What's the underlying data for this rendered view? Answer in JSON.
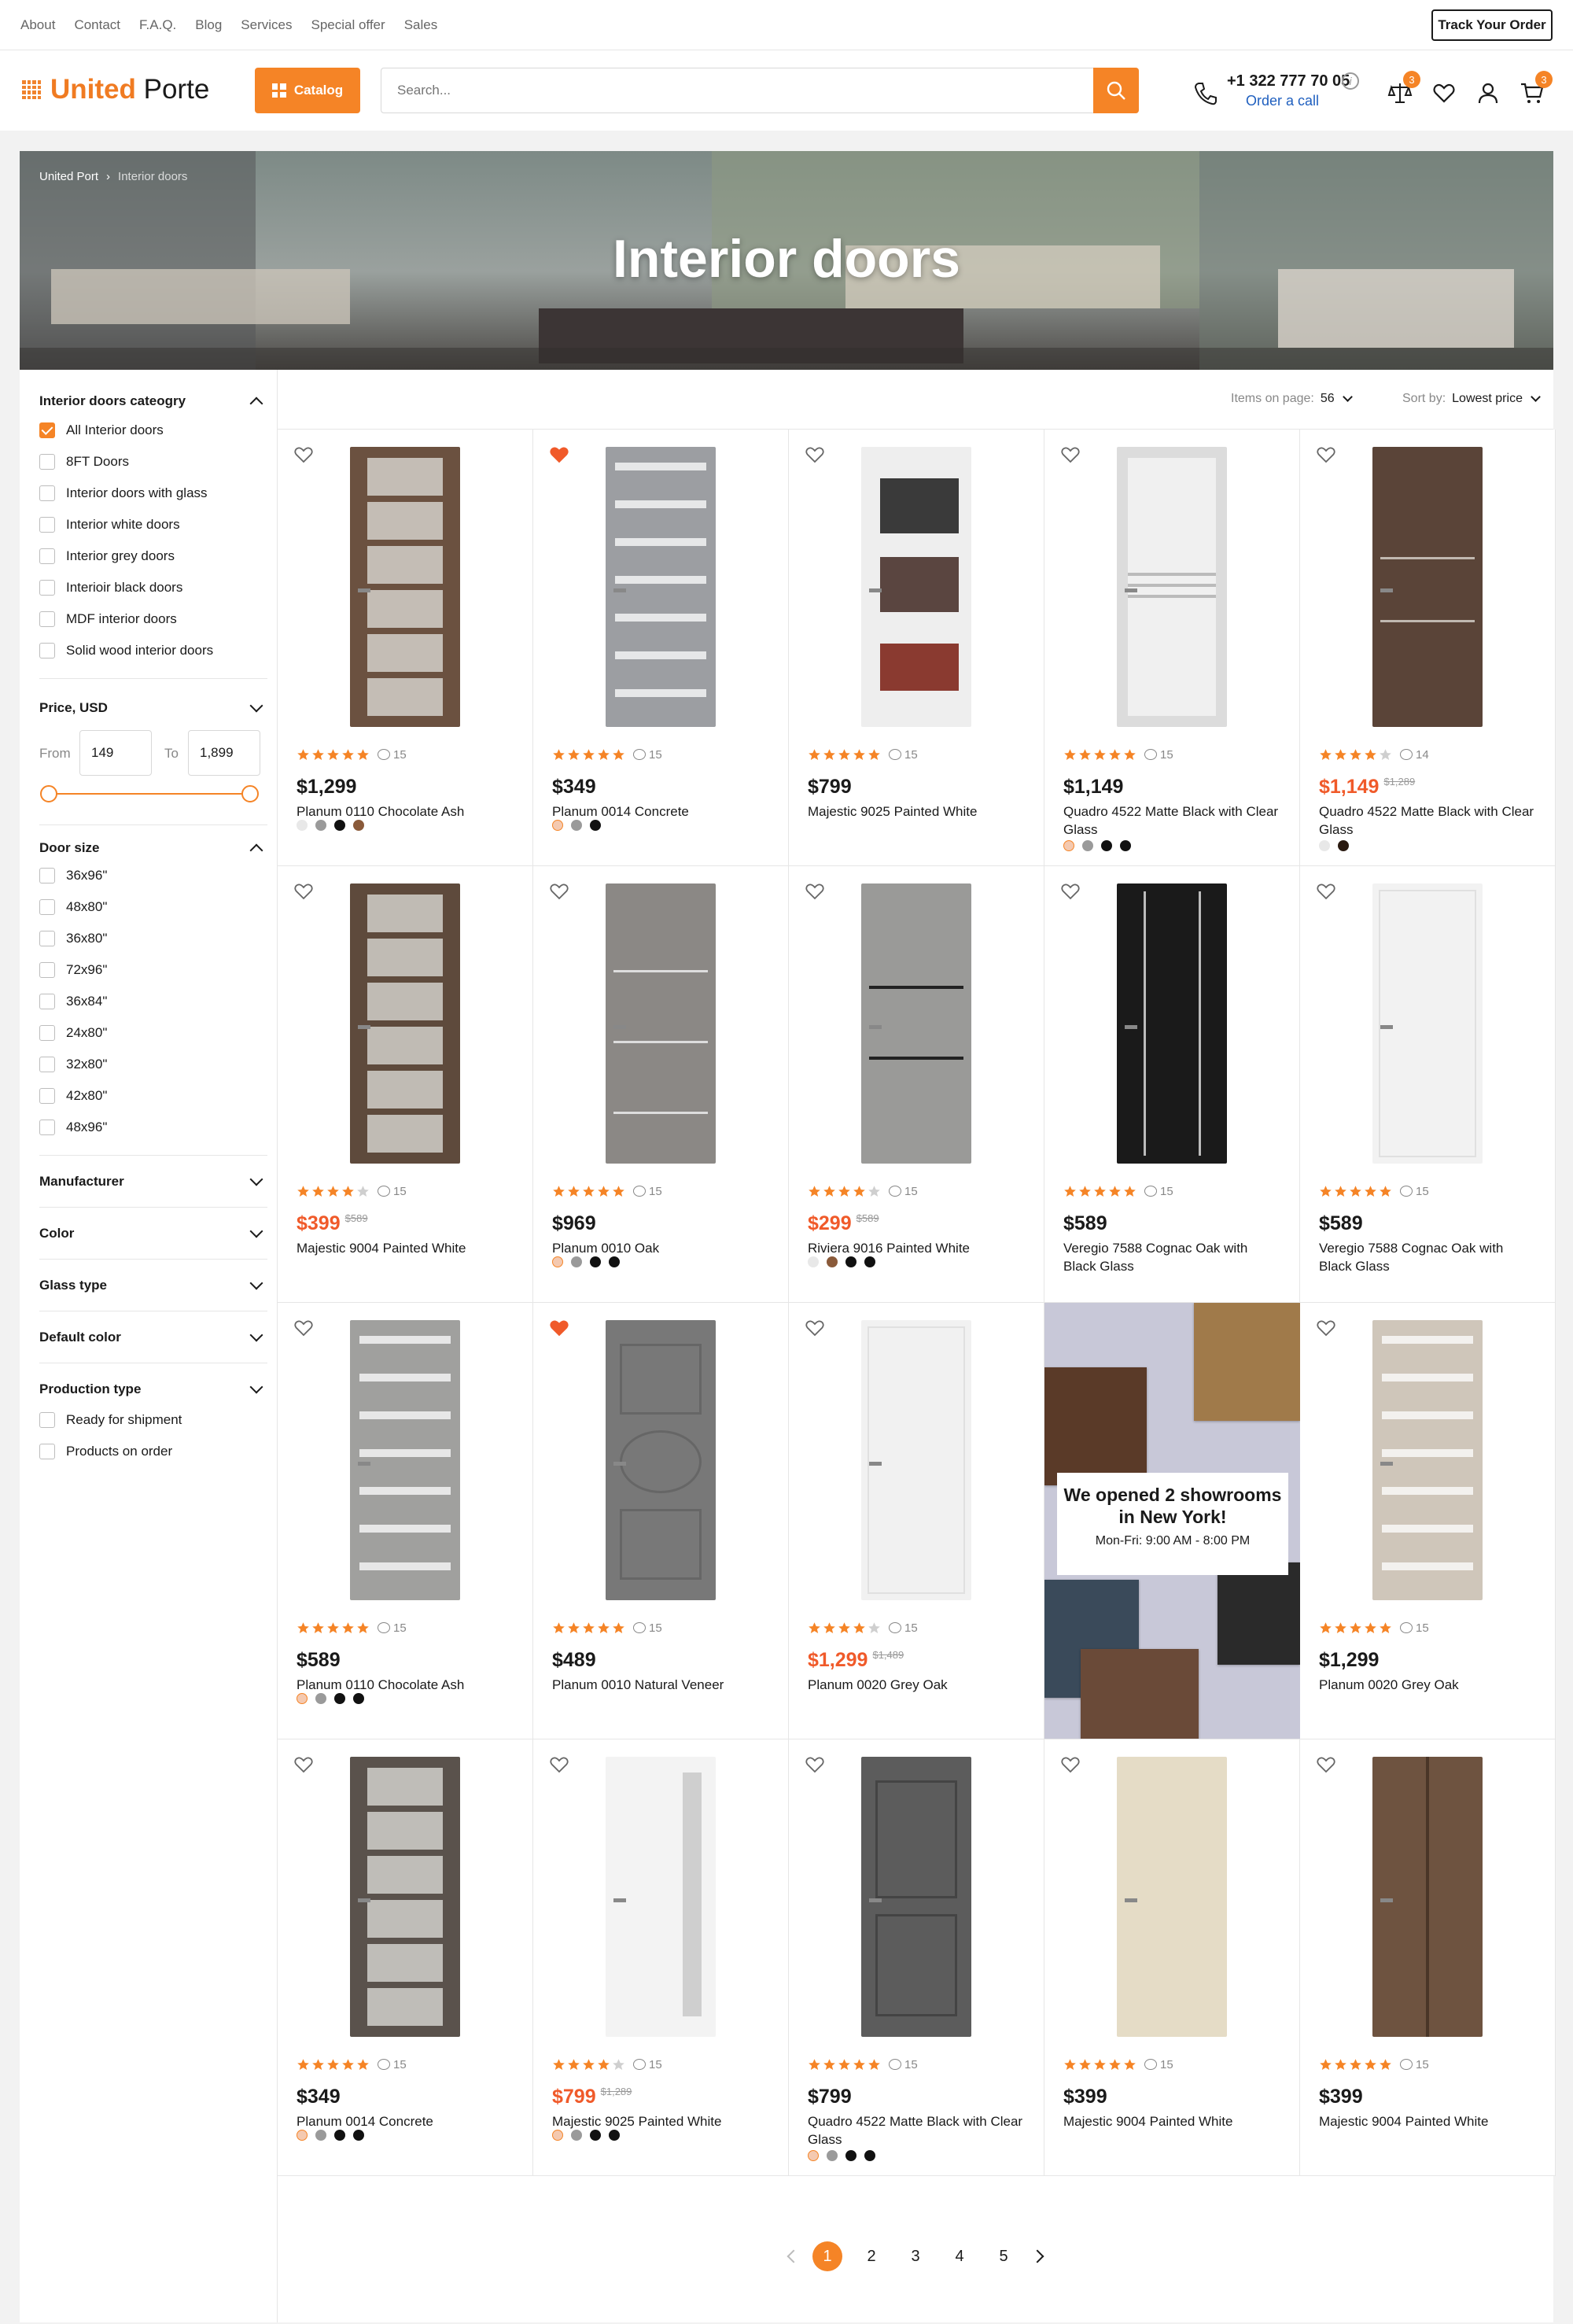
{
  "topnav": {
    "links": [
      "About",
      "Contact",
      "F.A.Q.",
      "Blog",
      "Services",
      "Special offer",
      "Sales"
    ],
    "track_label": "Track Your Order"
  },
  "header": {
    "logo_primary": "United",
    "logo_secondary": "Porte",
    "catalog_label": "Catalog",
    "search_placeholder": "Search...",
    "phone": "+1 322 777 70 05",
    "order_call": "Order a call",
    "compare_count": "3",
    "cart_count": "3",
    "accent": "#f58426",
    "link_color": "#1f5fbf"
  },
  "hero": {
    "crumbs": [
      "United Port",
      "Interior doors"
    ],
    "title": "Interior doors"
  },
  "filters": {
    "category": {
      "title": "Interior doors cateogry",
      "items": [
        {
          "label": "All Interior doors",
          "checked": true
        },
        {
          "label": "8FT Doors",
          "checked": false
        },
        {
          "label": "Interior doors with glass",
          "checked": false
        },
        {
          "label": "Interior white doors",
          "checked": false
        },
        {
          "label": "Interior grey doors",
          "checked": false
        },
        {
          "label": "Interioir black doors",
          "checked": false
        },
        {
          "label": "MDF interior doors",
          "checked": false
        },
        {
          "label": "Solid wood interior doors",
          "checked": false
        }
      ]
    },
    "price": {
      "title": "Price, USD",
      "from_label": "From",
      "to_label": "To",
      "min": "149",
      "max": "1,899"
    },
    "size": {
      "title": "Door size",
      "items": [
        "36x96\"",
        "48x80\"",
        "36x80\"",
        "72x96\"",
        "36x84\"",
        "24x80\"",
        "32x80\"",
        "42x80\"",
        "48x96\""
      ]
    },
    "collapsed": [
      "Manufacturer",
      "Color",
      "Glass type",
      "Default color"
    ],
    "production": {
      "title": "Production type",
      "items": [
        "Ready for shipment",
        "Products on order"
      ]
    }
  },
  "sort": {
    "items_label": "Items on page:",
    "items_value": "56",
    "sort_label": "Sort by:",
    "sort_value": "Lowest price"
  },
  "products": [
    {
      "name": "Planum 0110 Chocolate Ash",
      "price": "$1,299",
      "old": "",
      "stars": 5,
      "reviews": "15",
      "fav": false,
      "door": "#6b5140",
      "style": "glass6",
      "swatches": [
        "#e8e8e8",
        "#9a9a9a",
        "#111111",
        "#8a5a3a"
      ]
    },
    {
      "name": "Planum 0014 Concrete",
      "price": "$349",
      "old": "",
      "stars": 5,
      "reviews": "15",
      "fav": true,
      "door": "#9c9ea2",
      "style": "stripes",
      "swatches": [
        "#f4c9b0",
        "#9a9a9a",
        "#111111"
      ]
    },
    {
      "name": "Majestic 9025 Painted White",
      "price": "$799",
      "old": "",
      "stars": 5,
      "reviews": "15",
      "fav": false,
      "door": "#eeeeee",
      "style": "white3",
      "swatches": []
    },
    {
      "name": "Quadro 4522 Matte Black with Clear Glass",
      "price": "$1,149",
      "old": "",
      "stars": 5,
      "reviews": "15",
      "fav": false,
      "door": "#dcdcdc",
      "style": "frost",
      "swatches": [
        "#f4c9b0",
        "#9a9a9a",
        "#111111",
        "#111111"
      ]
    },
    {
      "name": "Quadro 4522 Matte Black with Clear Glass",
      "price": "$1,149",
      "old": "$1,289",
      "stars": 4,
      "reviews": "14",
      "fav": false,
      "door": "#5a4438",
      "style": "lines2",
      "swatches": [
        "#e8e8e8",
        "#2a1a10"
      ]
    },
    {
      "name": "Majestic 9004 Painted White",
      "price": "$399",
      "old": "$589",
      "stars": 4,
      "reviews": "15",
      "fav": false,
      "door": "#5e4a3c",
      "style": "glass6",
      "swatches": []
    },
    {
      "name": "Planum 0010 Oak",
      "price": "$969",
      "old": "",
      "stars": 5,
      "reviews": "15",
      "fav": false,
      "door": "#8b8885",
      "style": "lines3",
      "swatches": [
        "#f4c9b0",
        "#9a9a9a",
        "#111111",
        "#111111"
      ]
    },
    {
      "name": "Riviera 9016 Painted White",
      "price": "$299",
      "old": "$589",
      "stars": 4,
      "reviews": "15",
      "fav": false,
      "door": "#9a9a98",
      "style": "lines2d",
      "swatches": [
        "#e8e8e8",
        "#8a5a3a",
        "#111111",
        "#111111"
      ]
    },
    {
      "name": "Veregio 7588 Cognac Oak with Black Glass",
      "price": "$589",
      "old": "",
      "stars": 5,
      "reviews": "15",
      "fav": false,
      "door": "#1a1a1a",
      "style": "vlines",
      "swatches": []
    },
    {
      "name": "Veregio 7588 Cognac Oak with Black Glass",
      "price": "$589",
      "old": "",
      "stars": 5,
      "reviews": "15",
      "fav": false,
      "door": "#f2f2f2",
      "style": "whitelines",
      "swatches": []
    },
    {
      "name": "Planum 0110 Chocolate Ash",
      "price": "$589",
      "old": "",
      "stars": 5,
      "reviews": "15",
      "fav": false,
      "door": "#a0a09e",
      "style": "stripes",
      "swatches": [
        "#f4c9b0",
        "#9a9a9a",
        "#111111",
        "#111111"
      ]
    },
    {
      "name": "Planum 0010 Natural Veneer",
      "price": "$489",
      "old": "",
      "stars": 5,
      "reviews": "15",
      "fav": true,
      "door": "#787878",
      "style": "oval",
      "swatches": []
    },
    {
      "name": "Planum 0020 Grey Oak",
      "price": "$1,299",
      "old": "$1,489",
      "stars": 4,
      "reviews": "15",
      "fav": false,
      "door": "#f1f1f1",
      "style": "whitelines",
      "swatches": []
    },
    {
      "name": "__promo__"
    },
    {
      "name": "Planum 0020 Grey Oak",
      "price": "$1,299",
      "old": "",
      "stars": 5,
      "reviews": "15",
      "fav": false,
      "door": "#cfc6ba",
      "style": "stripes",
      "swatches": []
    },
    {
      "name": "Planum 0014 Concrete",
      "price": "$349",
      "old": "",
      "stars": 5,
      "reviews": "15",
      "fav": false,
      "door": "#5a524c",
      "style": "glass6",
      "swatches": [
        "#f4c9b0",
        "#9a9a9a",
        "#111111",
        "#111111"
      ]
    },
    {
      "name": "Majestic 9025 Painted White",
      "price": "$799",
      "old": "$1,289",
      "stars": 4,
      "reviews": "15",
      "fav": false,
      "door": "#f3f3f3",
      "style": "vglass",
      "swatches": [
        "#f4c9b0",
        "#9a9a9a",
        "#111111",
        "#111111"
      ]
    },
    {
      "name": "Quadro 4522 Matte Black with Clear Glass",
      "price": "$799",
      "old": "",
      "stars": 5,
      "reviews": "15",
      "fav": false,
      "door": "#5c5c5c",
      "style": "panel2",
      "swatches": [
        "#f4c9b0",
        "#9a9a9a",
        "#111111",
        "#111111"
      ]
    },
    {
      "name": "Majestic 9004 Painted White",
      "price": "$399",
      "old": "",
      "stars": 5,
      "reviews": "15",
      "fav": false,
      "door": "#e5dcc6",
      "style": "plain",
      "swatches": []
    },
    {
      "name": "Majestic 9004 Painted White",
      "price": "$399",
      "old": "",
      "stars": 5,
      "reviews": "15",
      "fav": false,
      "door": "#6e5340",
      "style": "vplank",
      "swatches": []
    }
  ],
  "promo": {
    "line1": "We opened 2 showrooms",
    "line2": "in New York!",
    "hours": "Mon-Fri: 9:00 AM - 8:00 PM"
  },
  "pagination": {
    "pages": [
      "1",
      "2",
      "3",
      "4",
      "5"
    ],
    "active": "1"
  }
}
